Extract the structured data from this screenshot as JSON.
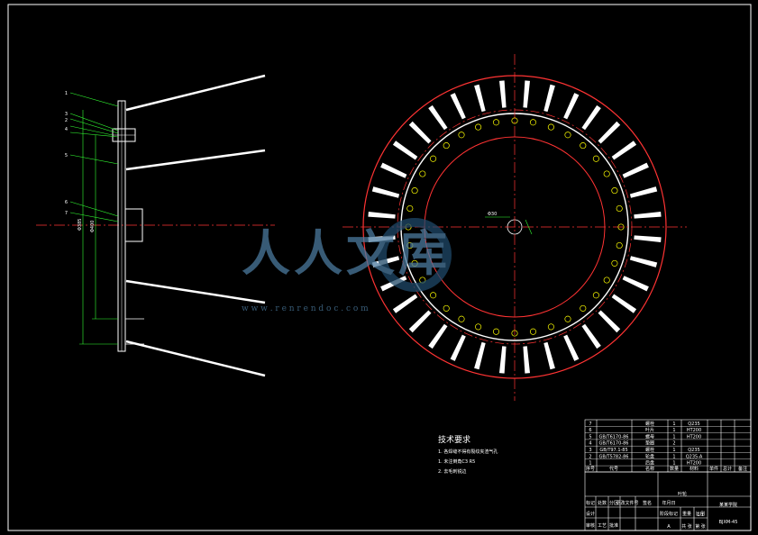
{
  "watermark": {
    "main": "人人文库",
    "url": "w w w . r e n r e n d o c . c o m"
  },
  "balloons": [
    "1",
    "3",
    "2",
    "4",
    "5",
    "6",
    "7"
  ],
  "dims": {
    "left_a": "Φ385",
    "left_b": "Φ400",
    "hub_label": "Φ30"
  },
  "tech_requirements": {
    "title": "技术要求",
    "items": [
      "1. 各焊缝不得有裂纹夹渣气孔",
      "1. 未注倒角C3  R5",
      "2. 去毛刺锐边"
    ]
  },
  "bom": {
    "rows": [
      {
        "no": "7",
        "code": "",
        "name": "螺栓",
        "qty": "1",
        "material": "Q235"
      },
      {
        "no": "6",
        "code": "",
        "name": "叶片",
        "qty": "1",
        "material": "HT200"
      },
      {
        "no": "5",
        "code": "GB/T6170-86",
        "name": "螺母",
        "qty": "1",
        "material": "HT200"
      },
      {
        "no": "4",
        "code": "GB/T6170-86",
        "name": "垫圈",
        "qty": "2",
        "material": ""
      },
      {
        "no": "3",
        "code": "GB/T97.1-85",
        "name": "螺栓",
        "qty": "1",
        "material": "Q235"
      },
      {
        "no": "2",
        "code": "GB/T5782-86",
        "name": "轮盘",
        "qty": "1",
        "material": "Q235-A"
      },
      {
        "no": "1",
        "code": "",
        "name": "后盘",
        "qty": "1",
        "material": "HT200"
      }
    ],
    "header": [
      "序号",
      "代号",
      "名称",
      "数量",
      "材料",
      "单件",
      "总计",
      "备注"
    ]
  },
  "title_block": {
    "part_name": "叶轮",
    "company": "某某学院",
    "drawing_no": "BJXM-45",
    "scale": "1:1",
    "sheet": "A",
    "labels": [
      "标记",
      "处数",
      "分区",
      "更改文件号",
      "签名",
      "年月日",
      "设计",
      "审核",
      "工艺",
      "批准",
      "阶段标记",
      "重量",
      "比例",
      "共 张",
      "第 张"
    ]
  },
  "colors": {
    "outline": "#ffffff",
    "center": "#ff3333",
    "annot": "#33ff33",
    "hole": "#ffff00",
    "wm_dark": "#1a3c5a",
    "wm_light": "#4b7a9e"
  }
}
